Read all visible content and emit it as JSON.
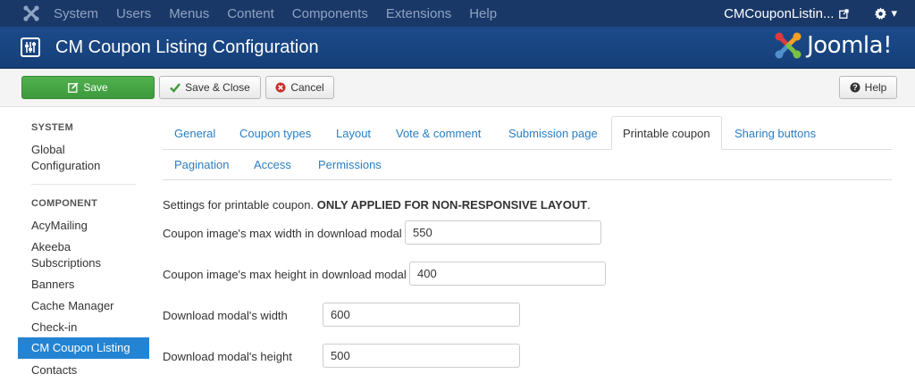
{
  "navbar": {
    "items": [
      "System",
      "Users",
      "Menus",
      "Content",
      "Components",
      "Extensions",
      "Help"
    ],
    "site_name": "CMCouponListin...",
    "gear_caret": "▾"
  },
  "header": {
    "title": "CM Coupon Listing Configuration",
    "brand": "Joomla!"
  },
  "toolbar": {
    "save_label": "Save",
    "save_close_label": "Save & Close",
    "cancel_label": "Cancel",
    "help_label": "Help"
  },
  "sidebar": {
    "system_heading": "SYSTEM",
    "global_config_line1": "Global",
    "global_config_line2": "Configuration",
    "component_heading": "COMPONENT",
    "items": [
      "AcyMailing",
      "Akeeba",
      "Subscriptions",
      "Banners",
      "Cache Manager",
      "Check-in",
      "CM Coupon Listing",
      "Contacts"
    ],
    "active_item": "CM Coupon Listing"
  },
  "tabs": {
    "row1": [
      "General",
      "Coupon types",
      "Layout",
      "Vote & comment",
      "Submission page",
      "Printable coupon",
      "Sharing buttons"
    ],
    "row2": [
      "Pagination",
      "Access",
      "Permissions"
    ],
    "active": "Printable coupon"
  },
  "content": {
    "desc_prefix": "Settings for printable coupon. ",
    "desc_bold": "ONLY APPLIED FOR NON-RESPONSIVE LAYOUT",
    "desc_suffix": ".",
    "fields": [
      {
        "label": "Coupon image's max width in download modal",
        "value": "550"
      },
      {
        "label": "Coupon image's max height in download modal",
        "value": "400"
      },
      {
        "label": "Download modal's width",
        "value": "600"
      },
      {
        "label": "Download modal's height",
        "value": "500"
      }
    ]
  },
  "colors": {
    "navbar_bg": "#1a3867",
    "header_bg": "#1c4b8a",
    "save_green": "#46a546",
    "link_blue": "#2a7ec2",
    "active_blue": "#2384d3"
  }
}
